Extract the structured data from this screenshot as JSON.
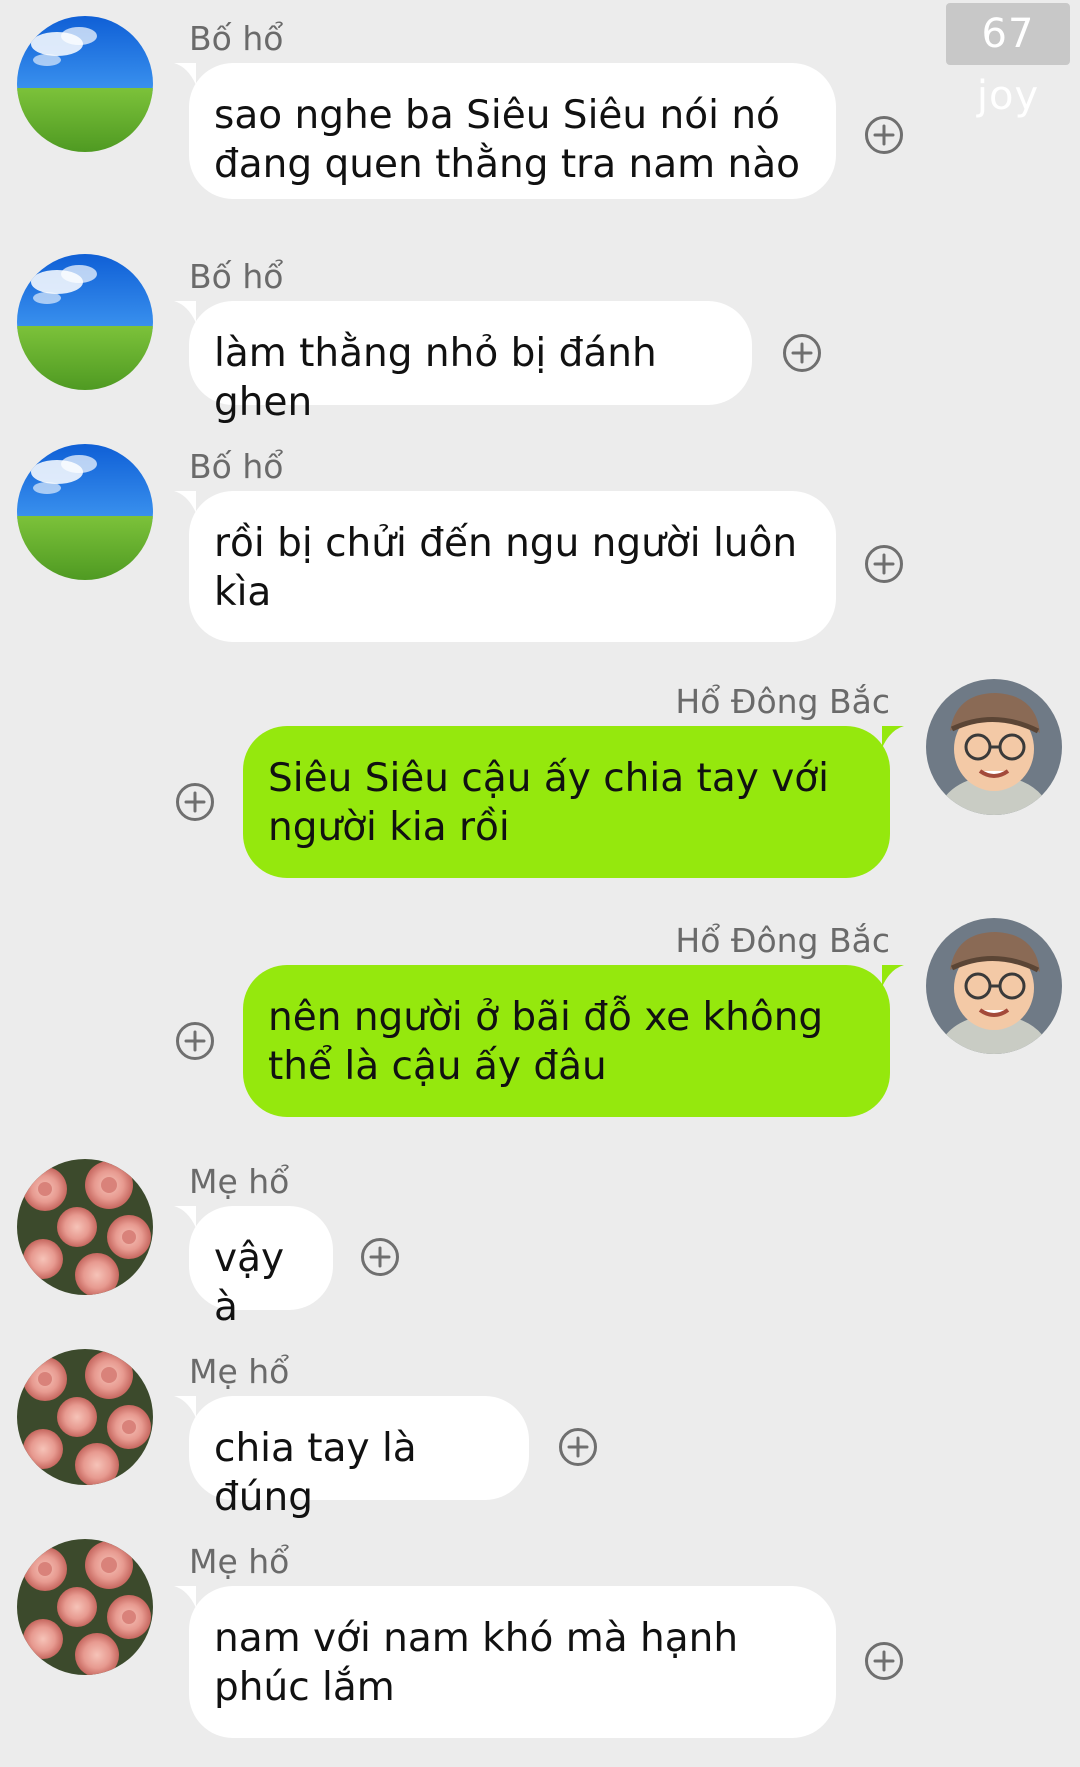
{
  "watermark": "67 joy",
  "messages": [
    {
      "sender": "Bố hổ",
      "side": "left",
      "avatar": "grass-sky-avatar",
      "text": "sao nghe ba Siêu Siêu nói nó đang quen thằng tra nam nào"
    },
    {
      "sender": "Bố hổ",
      "side": "left",
      "avatar": "grass-sky-avatar",
      "text": "làm thằng nhỏ bị đánh ghen"
    },
    {
      "sender": "Bố hổ",
      "side": "left",
      "avatar": "grass-sky-avatar",
      "text": "rồi bị chửi đến ngu người luôn kìa"
    },
    {
      "sender": "Hổ Đông Bắc",
      "side": "right",
      "avatar": "boy-with-cap-avatar",
      "text": "Siêu Siêu cậu ấy chia tay với người kia rồi"
    },
    {
      "sender": "Hổ Đông Bắc",
      "side": "right",
      "avatar": "boy-with-cap-avatar",
      "text": "nên người ở bãi đỗ xe không thể là cậu ấy đâu"
    },
    {
      "sender": "Mẹ hổ",
      "side": "left",
      "avatar": "roses-avatar",
      "text": "vậy à"
    },
    {
      "sender": "Mẹ hổ",
      "side": "left",
      "avatar": "roses-avatar",
      "text": "chia tay là đúng"
    },
    {
      "sender": "Mẹ hổ",
      "side": "left",
      "avatar": "roses-avatar",
      "text": "nam với nam khó mà hạnh phúc lắm"
    }
  ],
  "colors": {
    "background": "#ececec",
    "incoming_bubble": "#ffffff",
    "outgoing_bubble": "#95e80d",
    "sender_name": "#6a6a6a"
  },
  "icons": {
    "reaction": "plus-circle-icon"
  }
}
